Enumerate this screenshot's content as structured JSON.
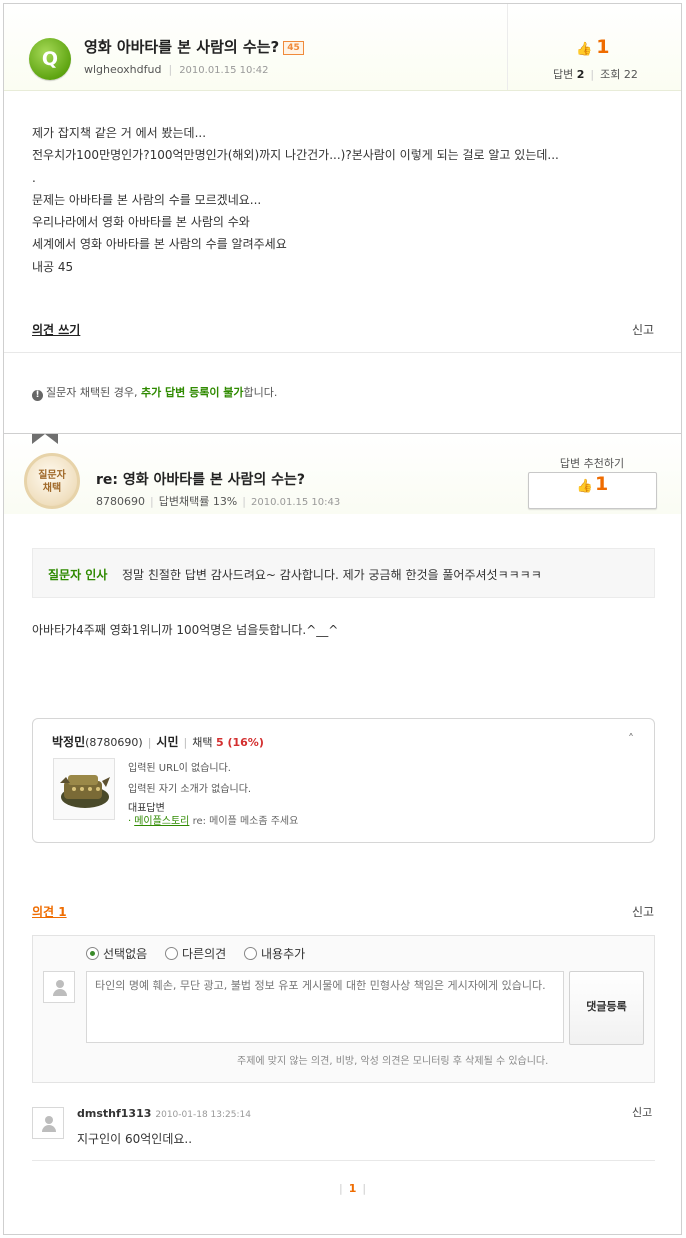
{
  "question": {
    "badge": "Q",
    "title": "영화 아바타를 본 사람의 수는?",
    "tag": "45",
    "author": "wlgheoxhdfud",
    "datetime": "2010.01.15 10:42",
    "likes": "1",
    "answers_label": "답변",
    "answers_count": "2",
    "views_label": "조회",
    "views_count": "22",
    "body": [
      "제가 잡지책 같은 거 에서 봤는데...",
      "전우치가100만명인가?100억만명인가(해외)까지 나간건가...)?본사람이 이렇게 되는 걸로 알고 있는데...",
      ".",
      "문제는 아바타를 본 사람의 수를 모르겠네요...",
      "우리나라에서 영화 아바타를 본 사람의 수와",
      "세계에서 영화 아바타를 본 사람의 수를 알려주세요",
      "내공 45"
    ],
    "opinion_write": "의견 쓰기",
    "report": "신고",
    "notice_pre": "질문자 채택된 경우, ",
    "notice_highlight": "추가 답변 등록이 불가",
    "notice_post": "합니다."
  },
  "answer": {
    "medal_line1": "질문자",
    "medal_line2": "채택",
    "title": "re: 영화 아바타를 본 사람의 수는?",
    "author_id": "8780690",
    "adopt_rate": "답변채택률 13%",
    "datetime": "2010.01.15 10:43",
    "recommend_label": "답변 추천하기",
    "recommend_count": "1",
    "greeting_label": "질문자 인사",
    "greeting_text": "정말 친절한 답변 감사드려요~ 감사합니다. 제가 궁금해 한것을 풀어주셔섯ㅋㅋㅋㅋ",
    "body": "아바타가4주째 영화1위니까 100억명은 넘을듯합니다.^__^"
  },
  "profile": {
    "name": "박정민",
    "id": "(8780690)",
    "rank": "시민",
    "adopt_label": "채택",
    "adopt_value": "5 (16%)",
    "collapse": "˄",
    "url_text": "입력된 URL이 없습니다.",
    "intro_text": "입력된 자기 소개가 없습니다.",
    "rep_label": "대표답변",
    "rep_link": "메이플스토리",
    "rep_title": "re: 메이플 메소좀 주세요"
  },
  "comments": {
    "count_label": "의견 1",
    "report": "신고",
    "options": [
      "선택없음",
      "다른의견",
      "내용추가"
    ],
    "placeholder": "타인의 명예 훼손, 무단 광고, 불법 정보 유포 게시물에 대한 민형사상 책임은 게시자에게 있습니다.",
    "submit": "댓글등록",
    "notice": "주제에 맞지 않는 의견, 비방, 악성 의견은 모니터링 후 삭제될 수 있습니다.",
    "items": [
      {
        "user": "dmsthf1313",
        "datetime": "2010-01-18 13:25:14",
        "text": "지구인이 60억인데요..",
        "report": "신고"
      }
    ]
  },
  "pager": {
    "current": "1"
  },
  "colors": {
    "accent": "#ef6c00",
    "green": "#2f8a00",
    "badge_green": "#6ab023"
  }
}
